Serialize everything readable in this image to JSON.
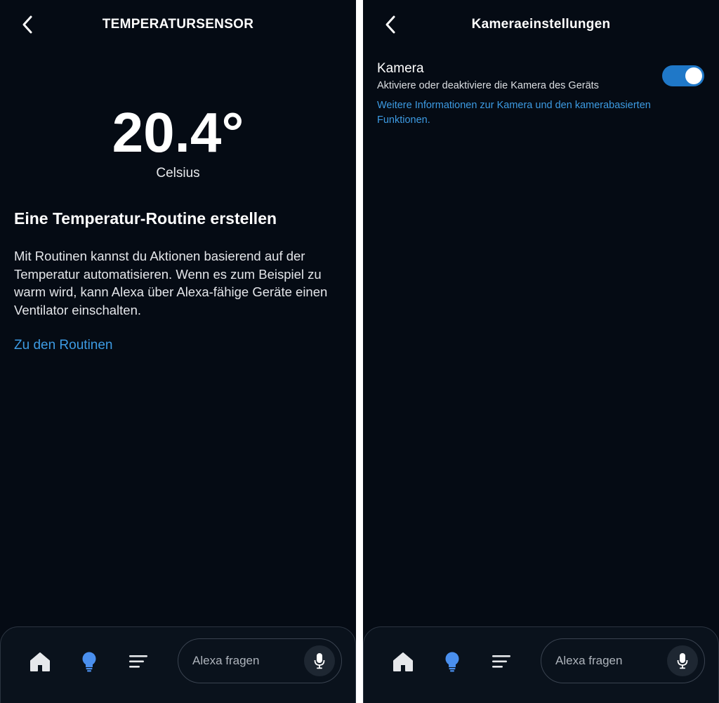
{
  "left_screen": {
    "title": "TEMPERATURSENSOR",
    "temperature": {
      "value": "20.4°",
      "unit": "Celsius"
    },
    "routine_section": {
      "heading": "Eine Temperatur-Routine erstellen",
      "body": "Mit Routinen kannst du Aktionen basierend auf der Temperatur automatisieren. Wenn es zum Beispiel zu warm wird, kann Alexa über Alexa-fähige Geräte einen Ventilator einschalten.",
      "link": "Zu den Routinen"
    }
  },
  "right_screen": {
    "title": "Kameraeinstellungen",
    "camera_setting": {
      "title": "Kamera",
      "description": "Aktiviere oder deaktiviere die Kamera des Geräts",
      "link": "Weitere Informationen zur Kamera und den kamerabasierten Funktionen.",
      "enabled": true
    }
  },
  "bottom_nav": {
    "items": [
      {
        "name": "home",
        "icon": "home-icon",
        "active": false
      },
      {
        "name": "devices",
        "icon": "lightbulb-icon",
        "active": true
      },
      {
        "name": "more",
        "icon": "menu-icon",
        "active": false
      }
    ],
    "ask_placeholder": "Alexa fragen",
    "mic_icon": "microphone-icon"
  },
  "colors": {
    "background": "#050b14",
    "accent_link": "#3d9be3",
    "toggle_on": "#1f78c8",
    "active_nav": "#4a8fee",
    "divider": "#ffffff"
  }
}
